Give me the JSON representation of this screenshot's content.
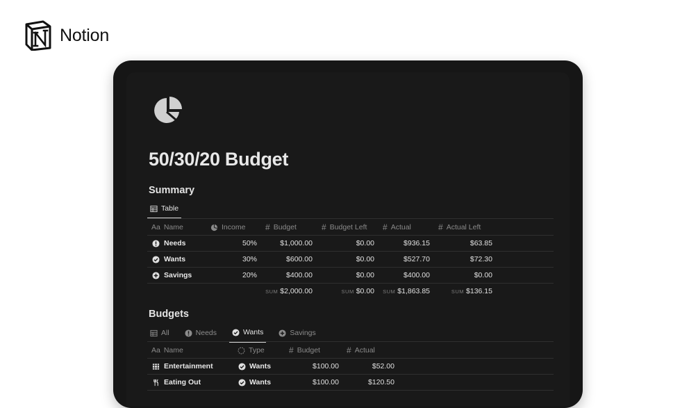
{
  "brand": {
    "name": "Notion"
  },
  "page": {
    "title": "50/30/20 Budget",
    "icon": "pie-chart-icon"
  },
  "summary": {
    "title": "Summary",
    "view_tab": "Table",
    "columns": {
      "name": "Name",
      "name_prefix": "Aa",
      "income": "Income",
      "budget": "Budget",
      "budget_left": "Budget Left",
      "actual": "Actual",
      "actual_left": "Actual Left"
    },
    "rows": [
      {
        "name": "Needs",
        "icon": "exclamation-circle-icon",
        "income": "50%",
        "budget": "$1,000.00",
        "budget_left": "$0.00",
        "actual": "$936.15",
        "actual_left": "$63.85"
      },
      {
        "name": "Wants",
        "icon": "check-circle-icon",
        "income": "30%",
        "budget": "$600.00",
        "budget_left": "$0.00",
        "actual": "$527.70",
        "actual_left": "$72.30"
      },
      {
        "name": "Savings",
        "icon": "plus-circle-icon",
        "income": "20%",
        "budget": "$400.00",
        "budget_left": "$0.00",
        "actual": "$400.00",
        "actual_left": "$0.00"
      }
    ],
    "sums": {
      "label": "SUM",
      "budget": "$2,000.00",
      "budget_left": "$0.00",
      "actual": "$1,863.85",
      "actual_left": "$136.15"
    }
  },
  "budgets": {
    "title": "Budgets",
    "tabs": [
      "All",
      "Needs",
      "Wants",
      "Savings"
    ],
    "active_tab": "Wants",
    "columns": {
      "name": "Name",
      "name_prefix": "Aa",
      "type": "Type",
      "budget": "Budget",
      "actual": "Actual"
    },
    "rows": [
      {
        "name": "Entertainment",
        "icon": "film-icon",
        "type": "Wants",
        "budget": "$100.00",
        "actual": "$52.00"
      },
      {
        "name": "Eating Out",
        "icon": "fork-knife-icon",
        "type": "Wants",
        "budget": "$100.00",
        "actual": "$120.50"
      }
    ]
  },
  "colors": {
    "background": "#ffffff",
    "device": "#161616",
    "screen": "#191919",
    "text": "#e3e3e3",
    "muted": "#8a8a8a"
  }
}
